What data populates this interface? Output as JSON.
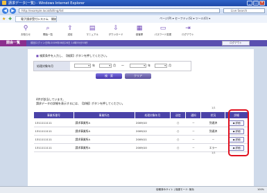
{
  "window": {
    "title": "請求データ(一覧) - Windows Internet Explorer"
  },
  "browser": {
    "address": "http://example.local/billing/list",
    "search_placeholder": "Live Search",
    "tab": "電子請求受付システム　開始一覧",
    "tools": "ページ(P) ▾  セーフティ(S) ▾  ツール(O) ▾"
  },
  "toolbar": {
    "items": [
      {
        "label": "お知らせ",
        "icon": "notice-icon"
      },
      {
        "label": "開始一覧",
        "icon": "search-icon"
      },
      {
        "label": "送信",
        "icon": "send-icon"
      },
      {
        "label": "マニュアル",
        "icon": "manual-icon"
      },
      {
        "label": "ダウンロード",
        "icon": "download-icon"
      },
      {
        "label": "保管庫",
        "icon": "archive-icon"
      },
      {
        "label": "パスワード変更",
        "icon": "password-icon"
      },
      {
        "label": "ログアウト",
        "icon": "logout-icon"
      }
    ]
  },
  "menubar": {
    "title": "開会一覧",
    "info": "前回ログイン日時:2009年08月28日 14時55分55秒",
    "logout": "ログアウト"
  },
  "panel": {
    "instruction": "検索条件を入力し、【検索】ボタンを押してください。",
    "filter_label": "処理対象年月",
    "year_unit": "年",
    "month_unit": "月",
    "range_sep": "〜",
    "search_button": "検　索",
    "clear_button": "クリア",
    "message_line1": "4件が該当しています。",
    "message_line2": "請求データの詳細を表示するには、【詳細】ボタンを押してください。",
    "page_top": "1/1",
    "page_bottom": "1/1"
  },
  "table": {
    "headers": [
      "事業所番号",
      "事業所名",
      "処理対象年月",
      "送信",
      "通知",
      "状況",
      "詳細"
    ],
    "rows": [
      [
        "1311111111",
        "請求事業所A",
        "2009/10",
        "○",
        "－",
        "到達済",
        "◆ 詳細"
      ],
      [
        "1311111111",
        "請求事業所A",
        "2009/12",
        "○",
        "－",
        "到達済",
        "◆ 詳細"
      ],
      [
        "1311111111",
        "請求事業所A",
        "2009/11",
        "○",
        "－",
        "－",
        "◆ 詳細"
      ],
      [
        "1311111111",
        "請求事業所A",
        "2009/10",
        "○",
        "－",
        "エラー",
        "◆ 詳細"
      ]
    ]
  },
  "status": {
    "zone": "信頼済みサイト | 保護モード: 無効",
    "zoom": "100%"
  }
}
